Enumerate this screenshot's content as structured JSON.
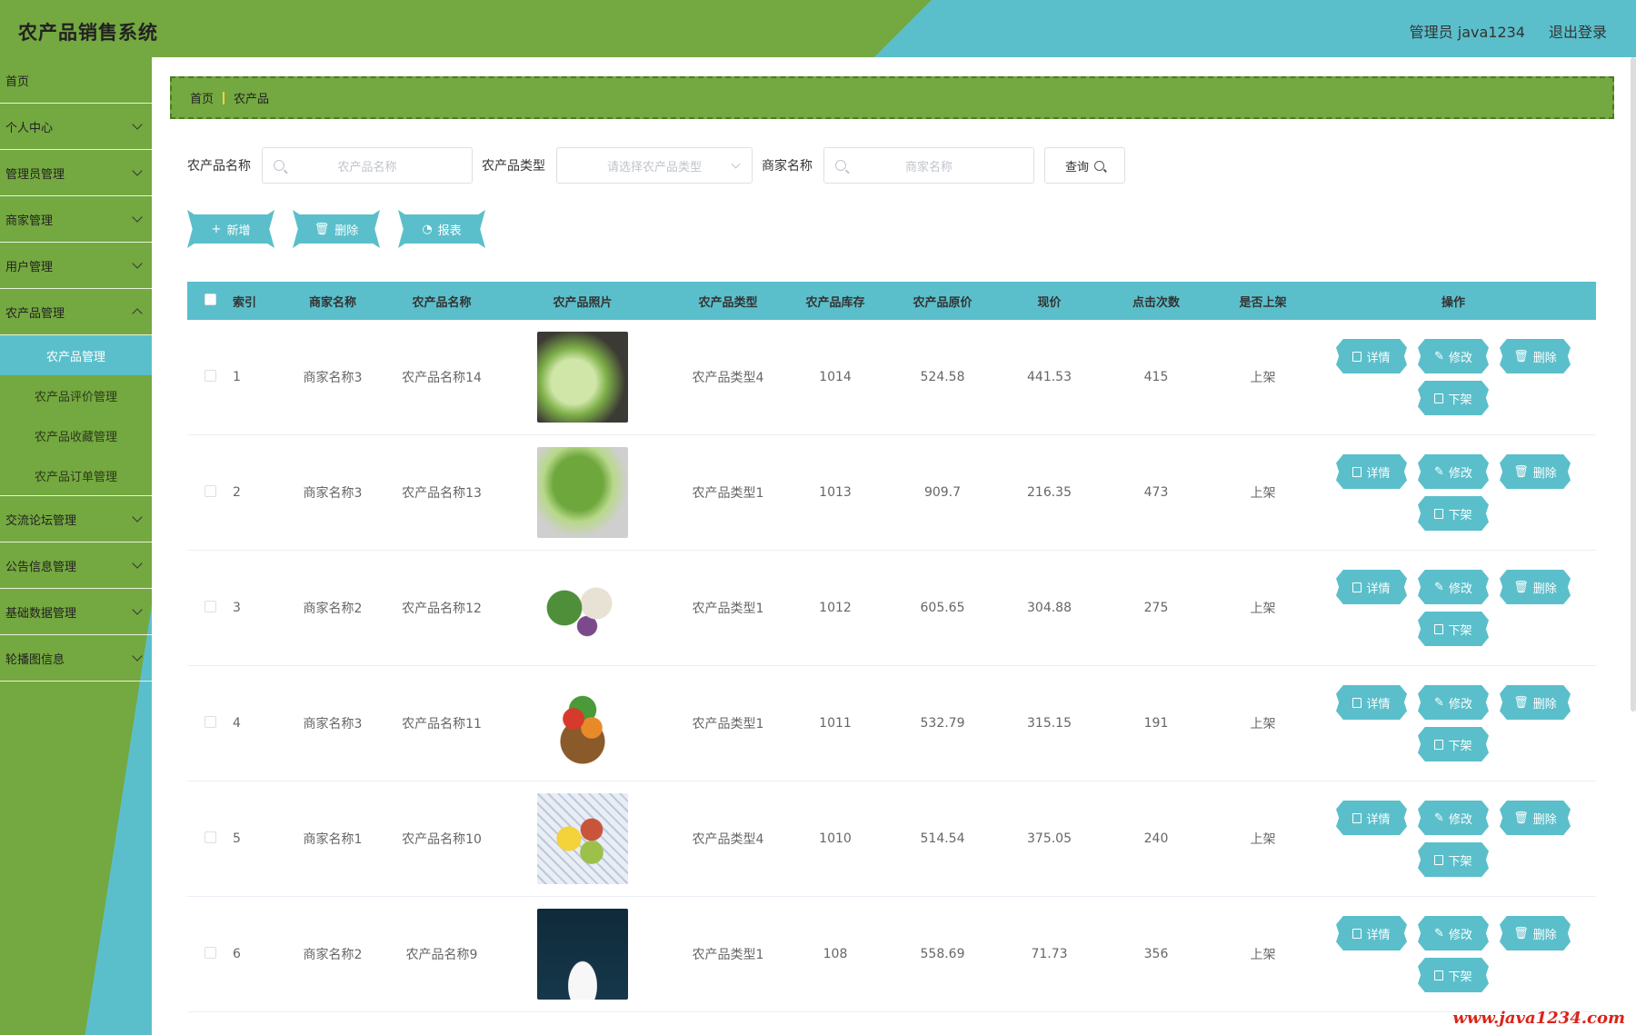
{
  "app": {
    "title": "农产品销售系统",
    "user": "管理员 java1234",
    "logout": "退出登录"
  },
  "sidebar": {
    "items": [
      {
        "label": "首页",
        "expandable": false
      },
      {
        "label": "个人中心",
        "expandable": true
      },
      {
        "label": "管理员管理",
        "expandable": true
      },
      {
        "label": "商家管理",
        "expandable": true
      },
      {
        "label": "用户管理",
        "expandable": true
      },
      {
        "label": "农产品管理",
        "expandable": true,
        "open": true,
        "children": [
          "农产品管理",
          "农产品评价管理",
          "农产品收藏管理",
          "农产品订单管理"
        ]
      },
      {
        "label": "交流论坛管理",
        "expandable": true
      },
      {
        "label": "公告信息管理",
        "expandable": true
      },
      {
        "label": "基础数据管理",
        "expandable": true
      },
      {
        "label": "轮播图信息",
        "expandable": true
      }
    ]
  },
  "breadcrumb": {
    "home": "首页",
    "current": "农产品"
  },
  "search": {
    "name_label": "农产品名称",
    "name_placeholder": "农产品名称",
    "type_label": "农产品类型",
    "type_placeholder": "请选择农产品类型",
    "merchant_label": "商家名称",
    "merchant_placeholder": "商家名称",
    "query_label": "查询"
  },
  "actions": {
    "add": "新增",
    "delete": "删除",
    "report": "报表"
  },
  "table": {
    "headers": [
      "索引",
      "商家名称",
      "农产品名称",
      "农产品照片",
      "农产品类型",
      "农产品库存",
      "农产品原价",
      "现价",
      "点击次数",
      "是否上架",
      "操作"
    ],
    "op_labels": {
      "detail": "详情",
      "edit": "修改",
      "delete": "删除",
      "offshelf": "下架"
    },
    "rows": [
      {
        "index": "1",
        "merchant": "商家名称3",
        "name": "农产品名称14",
        "type": "农产品类型4",
        "stock": "1014",
        "orig_price": "524.58",
        "price": "441.53",
        "clicks": "415",
        "shelf": "上架",
        "photo": "cabbage"
      },
      {
        "index": "2",
        "merchant": "商家名称3",
        "name": "农产品名称13",
        "type": "农产品类型1",
        "stock": "1013",
        "orig_price": "909.7",
        "price": "216.35",
        "clicks": "473",
        "shelf": "上架",
        "photo": "napa-cabbage"
      },
      {
        "index": "3",
        "merchant": "商家名称2",
        "name": "农产品名称12",
        "type": "农产品类型1",
        "stock": "1012",
        "orig_price": "605.65",
        "price": "304.88",
        "clicks": "275",
        "shelf": "上架",
        "photo": "vegetables"
      },
      {
        "index": "4",
        "merchant": "商家名称3",
        "name": "农产品名称11",
        "type": "农产品类型1",
        "stock": "1011",
        "orig_price": "532.79",
        "price": "315.15",
        "clicks": "191",
        "shelf": "上架",
        "photo": "vegetable-basket"
      },
      {
        "index": "5",
        "merchant": "商家名称1",
        "name": "农产品名称10",
        "type": "农产品类型4",
        "stock": "1010",
        "orig_price": "514.54",
        "price": "375.05",
        "clicks": "240",
        "shelf": "上架",
        "photo": "fruits"
      },
      {
        "index": "6",
        "merchant": "商家名称2",
        "name": "农产品名称9",
        "type": "农产品类型1",
        "stock": "108",
        "orig_price": "558.69",
        "price": "71.73",
        "clicks": "356",
        "shelf": "上架",
        "photo": "rice"
      }
    ]
  },
  "watermark": "www.java1234.com",
  "colors": {
    "green": "#74a840",
    "teal": "#5bbfcb",
    "watermark": "#d9241a"
  }
}
